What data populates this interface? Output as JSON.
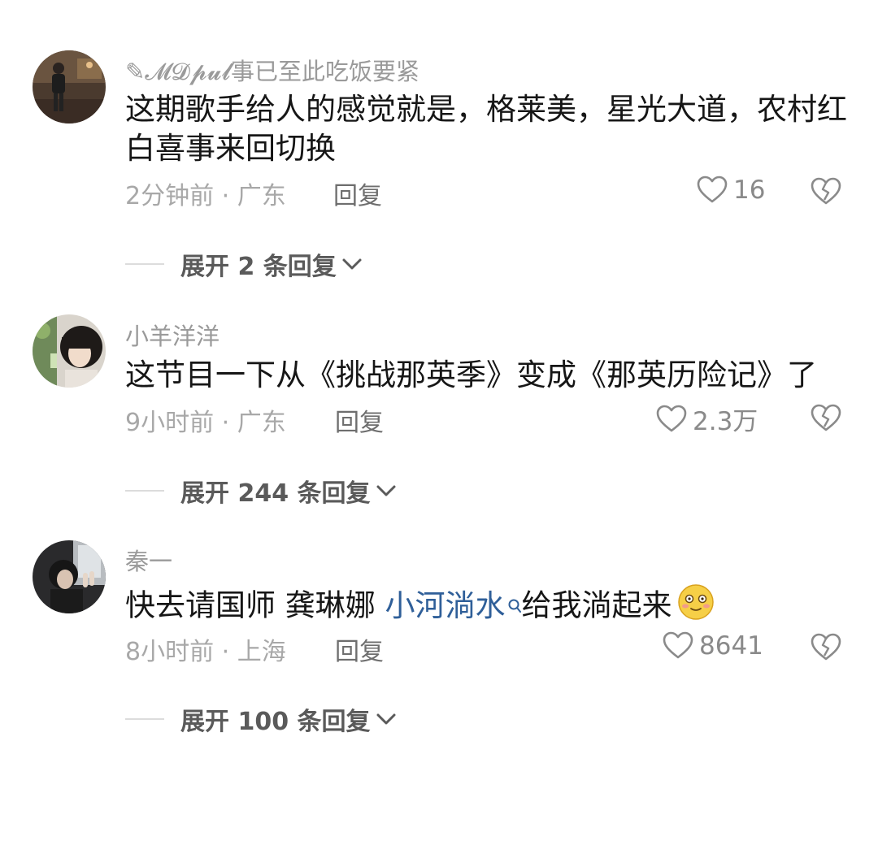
{
  "comments": [
    {
      "username": "✎𝓜𝓓𝓹𝓾𝓵事已至此吃饭要紧",
      "text": "这期歌手给人的感觉就是，格莱美，星光大道，农村红白喜事来回切换",
      "time": "2分钟前",
      "sep": "·",
      "location": "广东",
      "reply_label": "回复",
      "likes": "16",
      "expand_label": "展开 2 条回复",
      "avatar_icon": "person-photo-avatar"
    },
    {
      "username": "小羊洋洋",
      "text": "这节目一下从《挑战那英季》变成《那英历险记》了",
      "time": "9小时前",
      "sep": "·",
      "location": "广东",
      "reply_label": "回复",
      "likes": "2.3万",
      "expand_label": "展开 244 条回复",
      "avatar_icon": "girl-photo-avatar"
    },
    {
      "username": "秦一",
      "text_before": "快去请国师 龚琳娜 ",
      "mention": "小河淌水",
      "text_after": "给我淌起来",
      "time": "8小时前",
      "sep": "·",
      "location": "上海",
      "reply_label": "回复",
      "likes": "8641",
      "expand_label": "展开 100 条回复",
      "avatar_icon": "car-selfie-avatar",
      "emoji_icon": "blushing-smile-emoji"
    }
  ],
  "colors": {
    "heart": "#8a8a8a",
    "mention": "#2f5f99",
    "meta": "#a8a8a8"
  }
}
